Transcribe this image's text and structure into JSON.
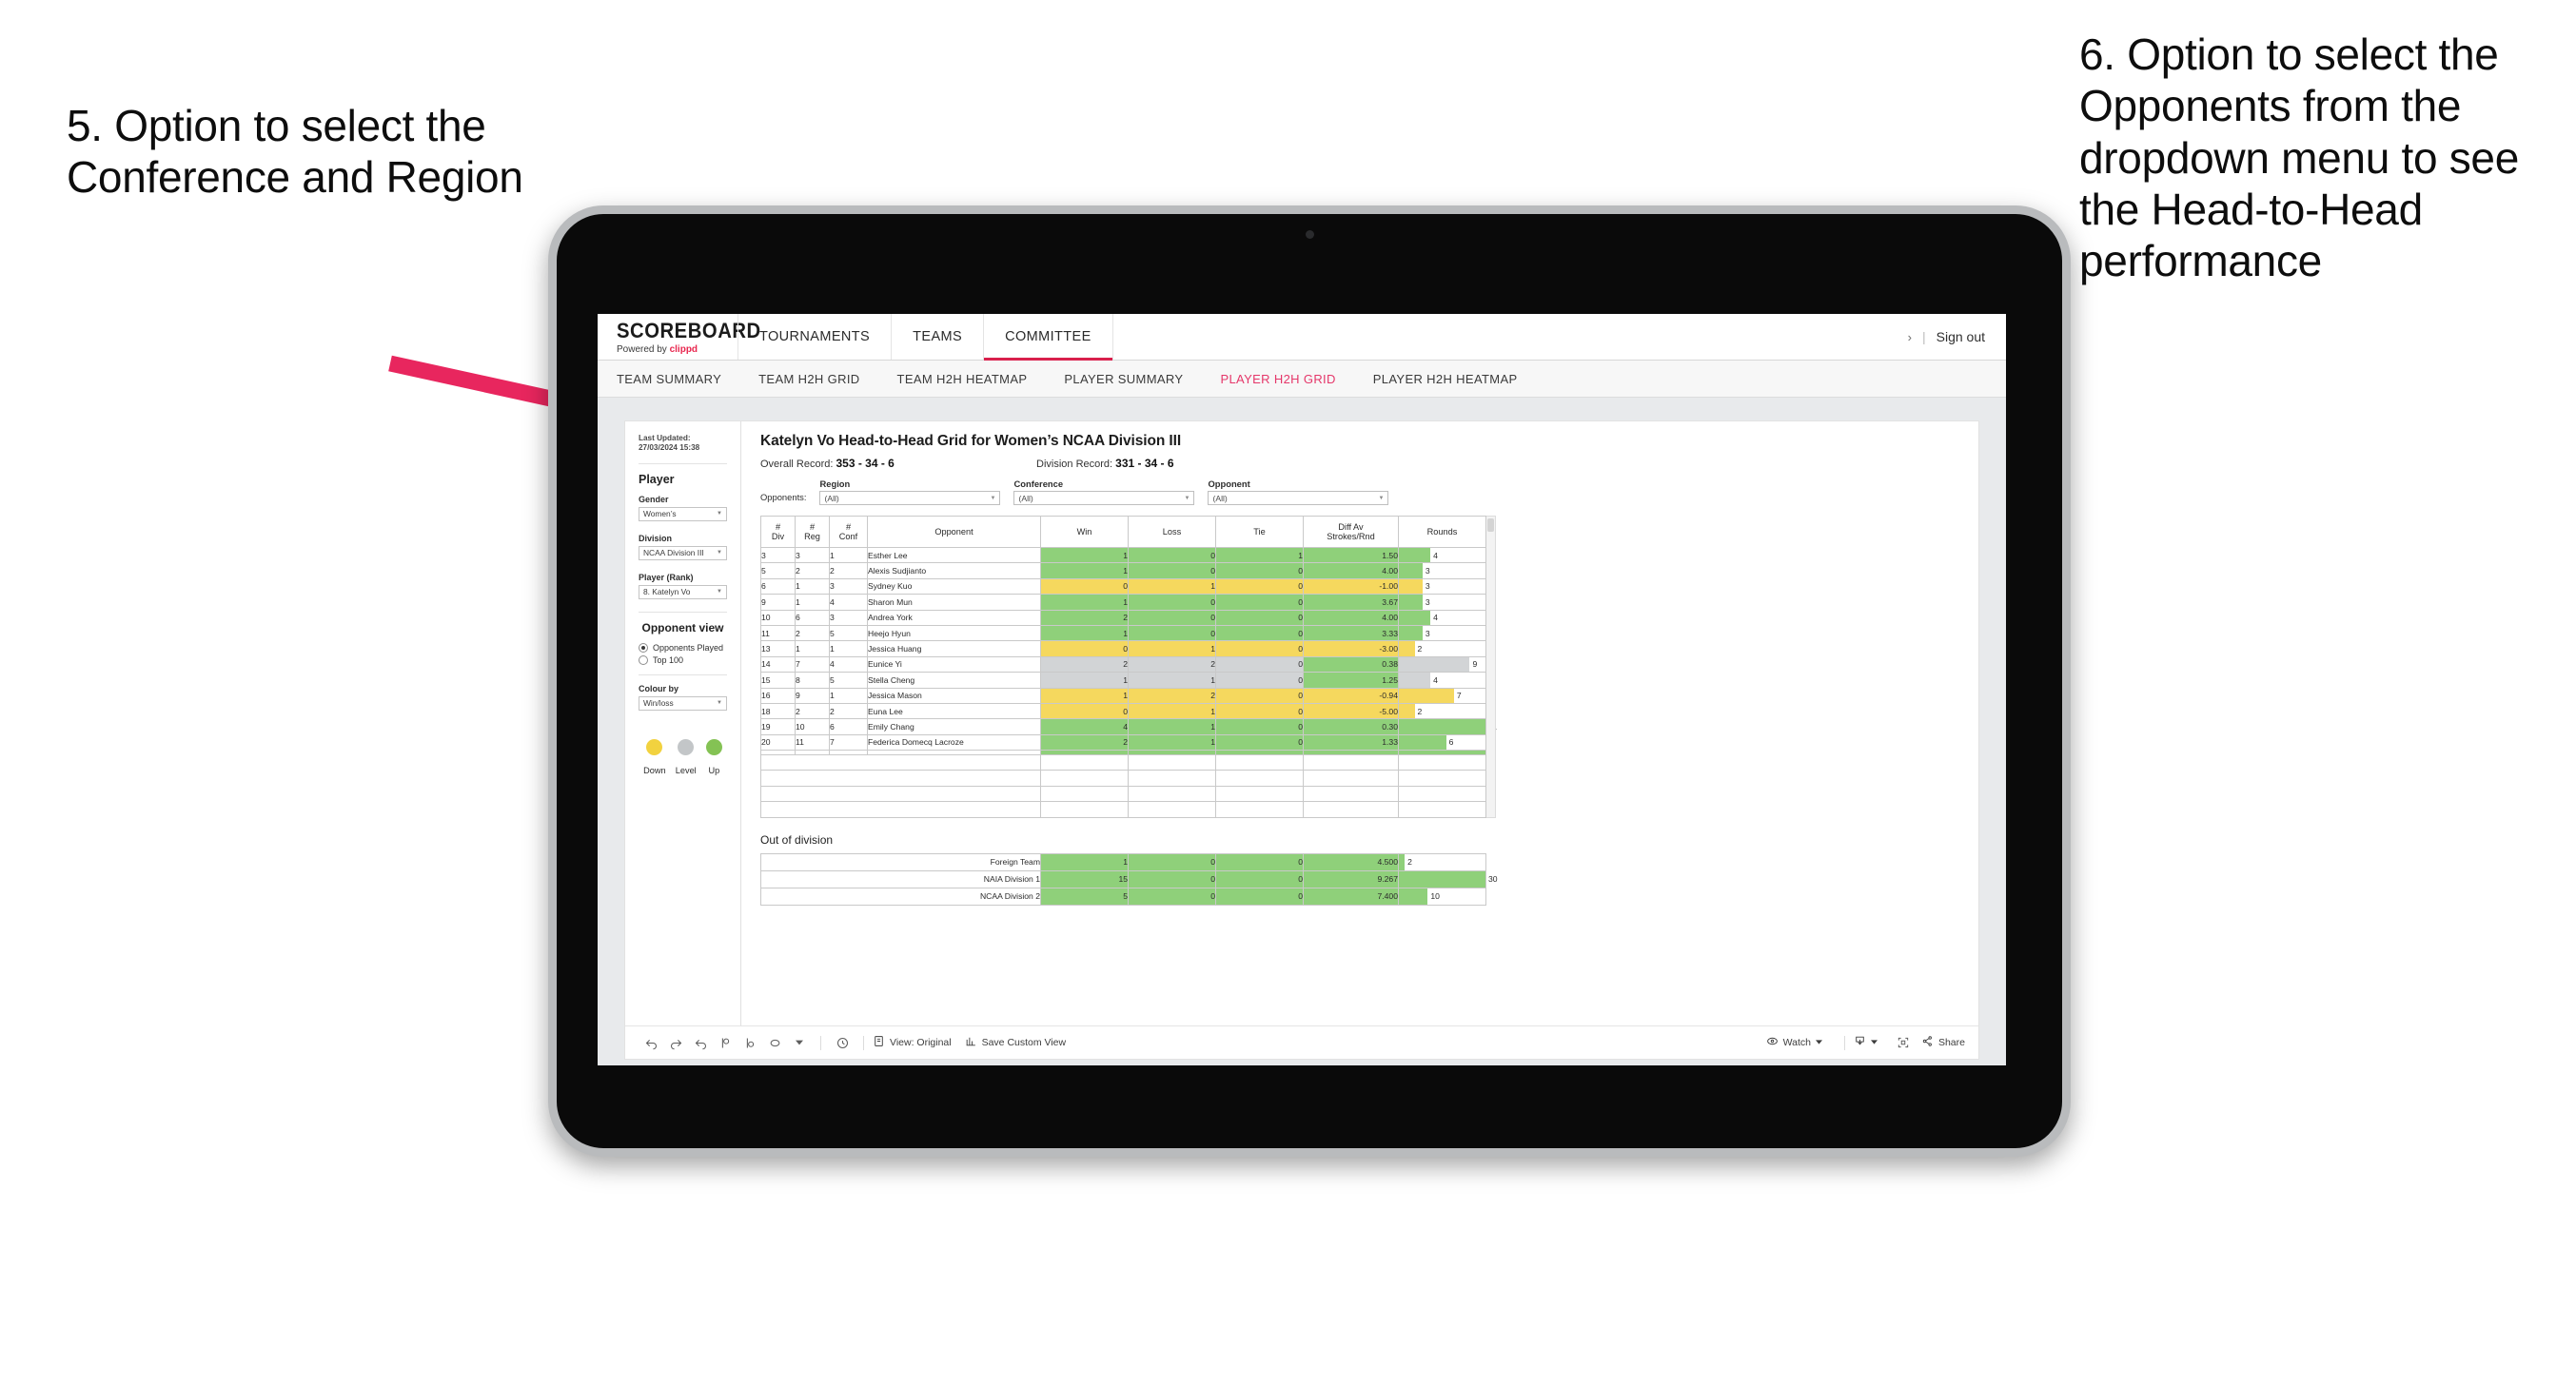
{
  "annotations": {
    "left": "5. Option to select the Conference and Region",
    "right": "6. Option to select the Opponents from the dropdown menu to see the Head-to-Head performance"
  },
  "appbar": {
    "brand_main": "SCOREBOARD",
    "brand_sub_prefix": "Powered by ",
    "brand_sub_name": "clippd",
    "nav": [
      {
        "label": "TOURNAMENTS",
        "active": false
      },
      {
        "label": "TEAMS",
        "active": false
      },
      {
        "label": "COMMITTEE",
        "active": true
      }
    ],
    "chevron": "›",
    "pipe": "|",
    "signout": "Sign out"
  },
  "subnav": [
    {
      "label": "TEAM SUMMARY",
      "active": false
    },
    {
      "label": "TEAM H2H GRID",
      "active": false
    },
    {
      "label": "TEAM H2H HEATMAP",
      "active": false
    },
    {
      "label": "PLAYER SUMMARY",
      "active": false
    },
    {
      "label": "PLAYER H2H GRID",
      "active": true
    },
    {
      "label": "PLAYER H2H HEATMAP",
      "active": false
    }
  ],
  "sidebar": {
    "last_updated": "Last Updated: 27/03/2024 15:38",
    "player_heading": "Player",
    "gender_label": "Gender",
    "gender_value": "Women’s",
    "division_label": "Division",
    "division_value": "NCAA Division III",
    "player_rank_label": "Player (Rank)",
    "player_rank_value": "8. Katelyn Vo",
    "opponent_view_heading": "Opponent view",
    "opponent_view_options": [
      {
        "label": "Opponents Played",
        "selected": true
      },
      {
        "label": "Top 100",
        "selected": false
      }
    ],
    "colour_by_label": "Colour by",
    "colour_by_value": "Win/loss",
    "legend": [
      {
        "label": "Down",
        "color": "#f2d23f"
      },
      {
        "label": "Level",
        "color": "#c3c6c8"
      },
      {
        "label": "Up",
        "color": "#84c254"
      }
    ]
  },
  "main": {
    "title": "Katelyn Vo Head-to-Head Grid for Women’s NCAA Division III",
    "overall_record_label": "Overall Record: ",
    "overall_record_value": "353 -  34 - 6",
    "division_record_label": "Division Record: ",
    "division_record_value": "331 -  34 - 6",
    "opponents_label": "Opponents:",
    "filters": [
      {
        "label": "Region",
        "value": "(All)"
      },
      {
        "label": "Conference",
        "value": "(All)"
      },
      {
        "label": "Opponent",
        "value": "(All)"
      }
    ],
    "out_of_division_heading": "Out of division"
  },
  "chart_data": {
    "type": "table",
    "title": "Katelyn Vo Head-to-Head Grid for Women’s NCAA Division III",
    "columns": [
      "# Div",
      "# Reg",
      "# Conf",
      "Opponent",
      "Win",
      "Loss",
      "Tie",
      "Diff Av Strokes/Rnd",
      "Rounds"
    ],
    "header_lines": [
      [
        "#",
        "Div"
      ],
      [
        "#",
        "Reg"
      ],
      [
        "#",
        "Conf"
      ],
      [
        "Opponent"
      ],
      [
        "Win"
      ],
      [
        "Loss"
      ],
      [
        "Tie"
      ],
      [
        "Diff Av",
        "Strokes/Rnd"
      ],
      [
        "Rounds"
      ]
    ],
    "rounds_max": 11,
    "rows": [
      {
        "div": "3",
        "reg": "3",
        "conf": "1",
        "opponent": "Esther Lee",
        "win": "1",
        "loss": "0",
        "tie": "1",
        "diff": "1.50",
        "rounds": "4",
        "rounds_n": 4,
        "color": "#8fd07a"
      },
      {
        "div": "5",
        "reg": "2",
        "conf": "2",
        "opponent": "Alexis Sudjianto",
        "win": "1",
        "loss": "0",
        "tie": "0",
        "diff": "4.00",
        "rounds": "3",
        "rounds_n": 3,
        "color": "#8fd07a"
      },
      {
        "div": "6",
        "reg": "1",
        "conf": "3",
        "opponent": "Sydney Kuo",
        "win": "0",
        "loss": "1",
        "tie": "0",
        "diff": "-1.00",
        "rounds": "3",
        "rounds_n": 3,
        "color": "#f5d85e"
      },
      {
        "div": "9",
        "reg": "1",
        "conf": "4",
        "opponent": "Sharon Mun",
        "win": "1",
        "loss": "0",
        "tie": "0",
        "diff": "3.67",
        "rounds": "3",
        "rounds_n": 3,
        "color": "#8fd07a"
      },
      {
        "div": "10",
        "reg": "6",
        "conf": "3",
        "opponent": "Andrea York",
        "win": "2",
        "loss": "0",
        "tie": "0",
        "diff": "4.00",
        "rounds": "4",
        "rounds_n": 4,
        "color": "#8fd07a"
      },
      {
        "div": "11",
        "reg": "2",
        "conf": "5",
        "opponent": "Heejo Hyun",
        "win": "1",
        "loss": "0",
        "tie": "0",
        "diff": "3.33",
        "rounds": "3",
        "rounds_n": 3,
        "color": "#8fd07a"
      },
      {
        "div": "13",
        "reg": "1",
        "conf": "1",
        "opponent": "Jessica Huang",
        "win": "0",
        "loss": "1",
        "tie": "0",
        "diff": "-3.00",
        "rounds": "2",
        "rounds_n": 2,
        "color": "#f5d85e"
      },
      {
        "div": "14",
        "reg": "7",
        "conf": "4",
        "opponent": "Eunice Yi",
        "win": "2",
        "loss": "2",
        "tie": "0",
        "diff": "0.38",
        "rounds": "9",
        "rounds_n": 9,
        "color": "#d2d4d6",
        "diff_color": "#8fd07a"
      },
      {
        "div": "15",
        "reg": "8",
        "conf": "5",
        "opponent": "Stella Cheng",
        "win": "1",
        "loss": "1",
        "tie": "0",
        "diff": "1.25",
        "rounds": "4",
        "rounds_n": 4,
        "color": "#d2d4d6",
        "diff_color": "#8fd07a"
      },
      {
        "div": "16",
        "reg": "9",
        "conf": "1",
        "opponent": "Jessica Mason",
        "win": "1",
        "loss": "2",
        "tie": "0",
        "diff": "-0.94",
        "rounds": "7",
        "rounds_n": 7,
        "color": "#f5d85e"
      },
      {
        "div": "18",
        "reg": "2",
        "conf": "2",
        "opponent": "Euna Lee",
        "win": "0",
        "loss": "1",
        "tie": "0",
        "diff": "-5.00",
        "rounds": "2",
        "rounds_n": 2,
        "color": "#f5d85e"
      },
      {
        "div": "19",
        "reg": "10",
        "conf": "6",
        "opponent": "Emily Chang",
        "win": "4",
        "loss": "1",
        "tie": "0",
        "diff": "0.30",
        "rounds": "11",
        "rounds_n": 11,
        "color": "#8fd07a"
      },
      {
        "div": "20",
        "reg": "11",
        "conf": "7",
        "opponent": "Federica Domecq Lacroze",
        "win": "2",
        "loss": "1",
        "tie": "0",
        "diff": "1.33",
        "rounds": "6",
        "rounds_n": 6,
        "color": "#8fd07a"
      }
    ],
    "out_of_division": {
      "rounds_max": 30,
      "rows": [
        {
          "label": "Foreign Team",
          "win": "1",
          "loss": "0",
          "tie": "0",
          "diff": "4.500",
          "rounds": "2",
          "rounds_n": 2,
          "color": "#8fd07a"
        },
        {
          "label": "NAIA Division 1",
          "win": "15",
          "loss": "0",
          "tie": "0",
          "diff": "9.267",
          "rounds": "30",
          "rounds_n": 30,
          "color": "#8fd07a"
        },
        {
          "label": "NCAA Division 2",
          "win": "5",
          "loss": "0",
          "tie": "0",
          "diff": "7.400",
          "rounds": "10",
          "rounds_n": 10,
          "color": "#8fd07a"
        }
      ]
    }
  },
  "vizbar": {
    "view_original": "View: Original",
    "save_custom_view": "Save Custom View",
    "watch": "Watch",
    "share": "Share"
  }
}
